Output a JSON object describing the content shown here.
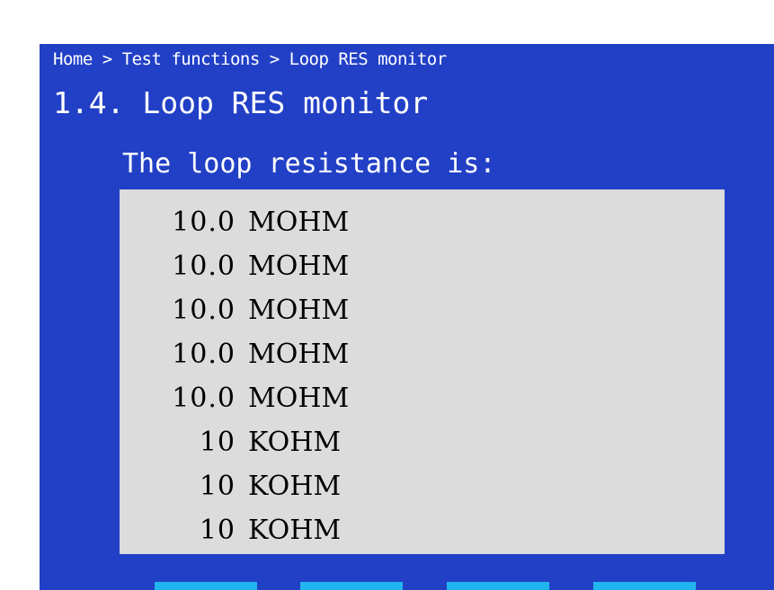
{
  "breadcrumb": {
    "home": "Home",
    "sep1": ">",
    "level2": "Test functions",
    "sep2": ">",
    "current": "Loop RES monitor"
  },
  "page_title": "1.4. Loop RES monitor",
  "subtitle": "The loop resistance is:",
  "readings": [
    {
      "value": "10.0",
      "unit": "MOHM"
    },
    {
      "value": "10.0",
      "unit": "MOHM"
    },
    {
      "value": "10.0",
      "unit": "MOHM"
    },
    {
      "value": "10.0",
      "unit": "MOHM"
    },
    {
      "value": "10.0",
      "unit": "MOHM"
    },
    {
      "value": "10",
      "unit": "KOHM"
    },
    {
      "value": "10",
      "unit": "KOHM"
    },
    {
      "value": "10",
      "unit": "KOHM"
    }
  ],
  "colors": {
    "screen_background": "#2240c6",
    "readings_background": "#dcdcdc",
    "softkey": "#21b5f0"
  }
}
